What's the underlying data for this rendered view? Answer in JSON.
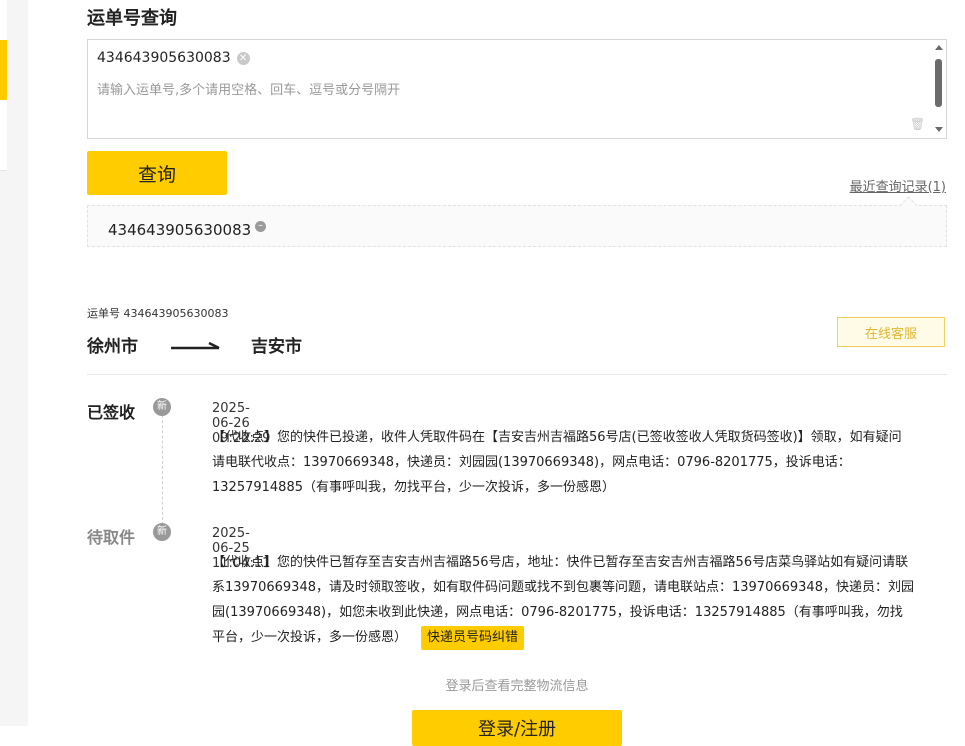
{
  "query": {
    "title": "运单号查询",
    "tag_value": "434643905630083",
    "placeholder": "请输入运单号,多个请用空格、回车、逗号或分号隔开",
    "button_label": "查询",
    "recent_link": "最近查询记录(1)",
    "history_items": [
      "434643905630083"
    ]
  },
  "result": {
    "waybill_label": "运单号 434643905630083",
    "from_city": "徐州市",
    "to_city": "吉安市",
    "service_button": "在线客服",
    "events": [
      {
        "status": "已签收",
        "badge": "新",
        "time": "2025-06-26 09:22:29",
        "desc": "【代收点】您的快件已投递，收件人凭取件码在【吉安吉州吉福路56号店(已签收签收人凭取货码签收)】领取，如有疑问请电联代收点：13970669348，快递员：刘园园(13970669348)，网点电话：0796-8201775，投诉电话：13257914885（有事呼叫我，勿找平台，少一次投诉，多一份感恩）"
      },
      {
        "status": "待取件",
        "badge": "新",
        "time": "2025-06-25 11:04:11",
        "desc": "【代收点】您的快件已暂存至吉安吉州吉福路56号店，地址：快件已暂存至吉安吉州吉福路56号店菜鸟驿站如有疑问请联系13970669348，请及时领取签收，如有取件码问题或找不到包裹等问题，请电联站点：13970669348，快递员：刘园园(13970669348)，如您未收到此快递，网点电话：0796-8201775，投诉电话：13257914885（有事呼叫我，勿找平台，少一次投诉，多一份感恩）",
        "action_label": "快递员号码纠错"
      }
    ],
    "login_hint": "登录后查看完整物流信息",
    "login_button": "登录/注册"
  },
  "colors": {
    "accent": "#ffcc00",
    "service_border": "#f2cf5e",
    "service_text": "#e0b732"
  },
  "icons": [
    "clear-icon",
    "trash-icon",
    "remove-icon",
    "arrow-right-icon",
    "new-badge-icon"
  ]
}
